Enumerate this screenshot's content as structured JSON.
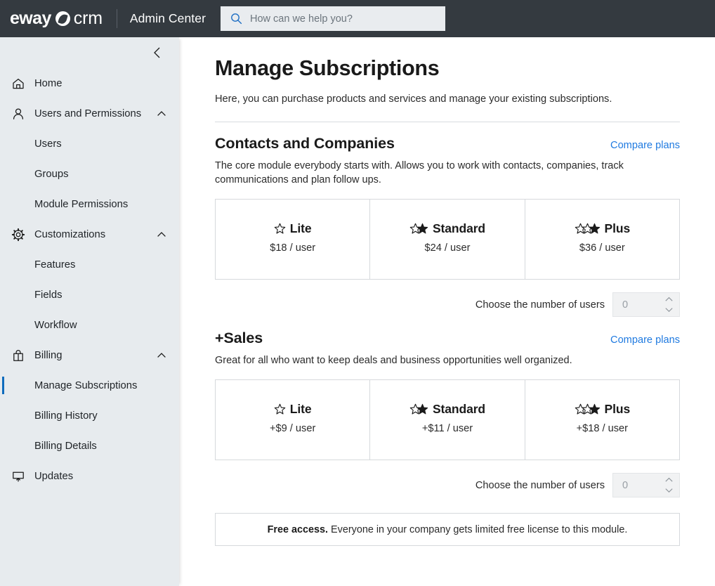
{
  "topbar": {
    "logo_primary": "eway",
    "logo_secondary": "crm",
    "logo_mark_icon": "eway-circle-mark-icon",
    "app_name": "Admin Center",
    "search_icon": "search-icon",
    "search_placeholder": "How can we help you?",
    "search_value": "",
    "background": "#343a40"
  },
  "sidebar": {
    "collapse_icon": "chevron-left-icon",
    "background": "#e7ebee",
    "active_indicator_color": "#0f6cbd",
    "items": [
      {
        "label": "Home",
        "icon": "home-icon",
        "level": "top",
        "expandable": false,
        "active": false
      },
      {
        "label": "Users and Permissions",
        "icon": "user-icon",
        "level": "top",
        "expandable": true,
        "expanded": true,
        "chevron": "chevron-up-icon",
        "active": false
      },
      {
        "label": "Users",
        "icon": "",
        "level": "sub",
        "expandable": false,
        "active": false
      },
      {
        "label": "Groups",
        "icon": "",
        "level": "sub",
        "expandable": false,
        "active": false
      },
      {
        "label": "Module Permissions",
        "icon": "",
        "level": "sub",
        "expandable": false,
        "active": false
      },
      {
        "label": "Customizations",
        "icon": "gear-icon",
        "level": "top",
        "expandable": true,
        "expanded": true,
        "chevron": "chevron-up-icon",
        "active": false
      },
      {
        "label": "Features",
        "icon": "",
        "level": "sub",
        "expandable": false,
        "active": false
      },
      {
        "label": "Fields",
        "icon": "",
        "level": "sub",
        "expandable": false,
        "active": false
      },
      {
        "label": "Workflow",
        "icon": "",
        "level": "sub",
        "expandable": false,
        "active": false
      },
      {
        "label": "Billing",
        "icon": "shopping-bag-icon",
        "level": "top",
        "expandable": true,
        "expanded": true,
        "chevron": "chevron-up-icon",
        "active": false
      },
      {
        "label": "Manage Subscriptions",
        "icon": "",
        "level": "sub",
        "expandable": false,
        "active": true
      },
      {
        "label": "Billing History",
        "icon": "",
        "level": "sub",
        "expandable": false,
        "active": false
      },
      {
        "label": "Billing Details",
        "icon": "",
        "level": "sub",
        "expandable": false,
        "active": false
      },
      {
        "label": "Updates",
        "icon": "monitor-update-icon",
        "level": "top",
        "expandable": false,
        "active": false
      }
    ]
  },
  "page": {
    "title": "Manage Subscriptions",
    "subtitle": "Here, you can purchase products and services and manage your existing subscriptions.",
    "link_color": "#1f7ae0"
  },
  "sections": [
    {
      "title": "Contacts and Companies",
      "compare_link": "Compare plans",
      "description": "The core module everybody starts with. Allows you to work with contacts, companies, track communications and plan follow ups.",
      "plans": [
        {
          "name": "Lite",
          "price": "$18 / user",
          "stars_outline": 1,
          "stars_filled": 0
        },
        {
          "name": "Standard",
          "price": "$24 / user",
          "stars_outline": 1,
          "stars_filled": 1
        },
        {
          "name": "Plus",
          "price": "$36 / user",
          "stars_outline": 2,
          "stars_filled": 1
        }
      ],
      "users_label": "Choose the number of users",
      "users_value": "0",
      "stepper_up_icon": "chevron-up-icon",
      "stepper_down_icon": "chevron-down-icon"
    },
    {
      "title": "+Sales",
      "compare_link": "Compare plans",
      "description": "Great for all who want to keep deals and business opportunities well organized.",
      "plans": [
        {
          "name": "Lite",
          "price": "+$9 / user",
          "stars_outline": 1,
          "stars_filled": 0
        },
        {
          "name": "Standard",
          "price": "+$11 / user",
          "stars_outline": 1,
          "stars_filled": 1
        },
        {
          "name": "Plus",
          "price": "+$18 / user",
          "stars_outline": 2,
          "stars_filled": 1
        }
      ],
      "users_label": "Choose the number of users",
      "users_value": "0",
      "stepper_up_icon": "chevron-up-icon",
      "stepper_down_icon": "chevron-down-icon"
    }
  ],
  "free_banner": {
    "bold": "Free access.",
    "text": "Everyone in your company gets limited free license to this module."
  }
}
